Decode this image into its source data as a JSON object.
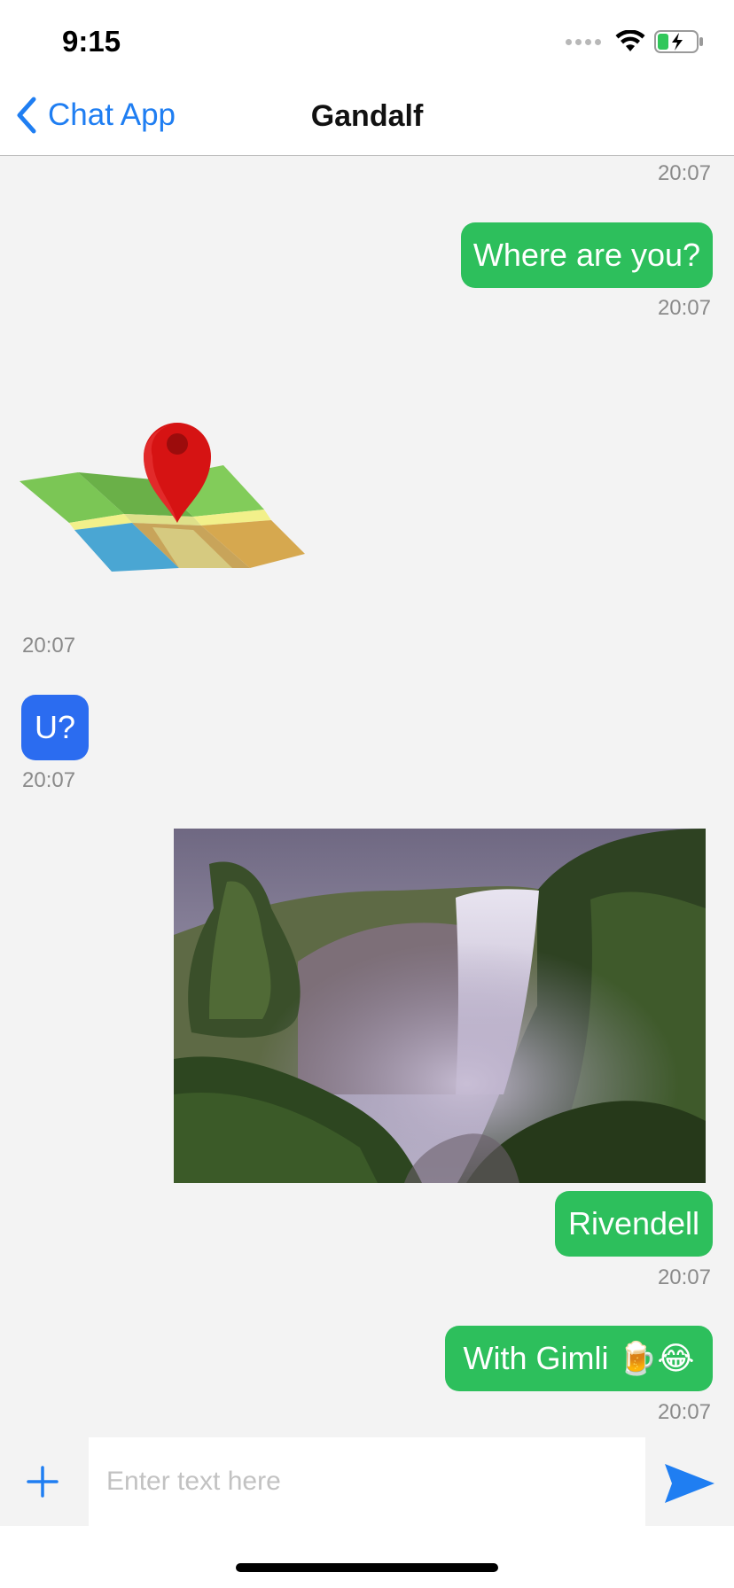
{
  "status_bar": {
    "time": "9:15",
    "icons": [
      "signal-dots-icon",
      "wifi-icon",
      "battery-charging-icon"
    ]
  },
  "nav": {
    "back_label": "Chat App",
    "title": "Gandalf"
  },
  "messages": [
    {
      "type": "timestamp",
      "time": "20:07"
    },
    {
      "type": "text",
      "side": "right",
      "text": "Where are you?",
      "time": "20:07"
    },
    {
      "type": "location",
      "side": "left",
      "icon": "map-pin-icon",
      "time": "20:07"
    },
    {
      "type": "text",
      "side": "left",
      "text": "U?",
      "time": "20:07"
    },
    {
      "type": "image",
      "side": "right",
      "icon": "waterfall-photo"
    },
    {
      "type": "text",
      "side": "right",
      "text": "Rivendell",
      "time": "20:07"
    },
    {
      "type": "text",
      "side": "right",
      "text": "With Gimli 🍺😂",
      "time": "20:07"
    }
  ],
  "input": {
    "placeholder": "Enter text here"
  },
  "colors": {
    "accent": "#1f7ef2",
    "outgoing_bubble": "#2dbf5c",
    "incoming_bubble": "#2b6cf0",
    "background": "#f3f3f3"
  }
}
